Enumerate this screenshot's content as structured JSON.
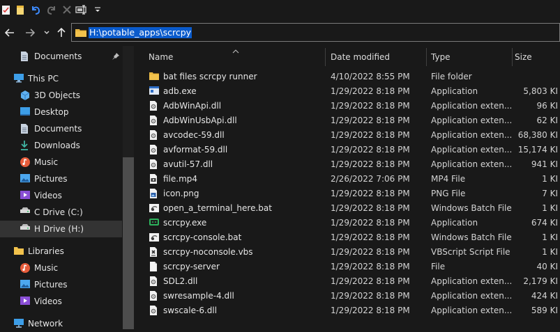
{
  "colors": {
    "background": "#191919",
    "address_selection": "#0a5bcc",
    "folder": "#f2c24c",
    "accent_blue": "#3d8bff"
  },
  "quick_access": [
    {
      "icon": "properties-icon"
    },
    {
      "icon": "new-folder-icon"
    },
    {
      "icon": "undo-icon"
    },
    {
      "icon": "redo-icon"
    },
    {
      "icon": "delete-icon"
    },
    {
      "icon": "rename-icon"
    },
    {
      "icon": "customize-dropdown-icon"
    }
  ],
  "nav": {
    "back_icon": "back-arrow-icon",
    "forward_icon": "forward-arrow-icon",
    "recent_icon": "recent-dropdown-icon",
    "up_icon": "up-arrow-icon",
    "address": "H:\\potable_apps\\scrcpy"
  },
  "sidebar": {
    "items": [
      {
        "label": "Documents",
        "icon": "documents-icon",
        "indent": 1,
        "pinned": true
      },
      {
        "label": "This PC",
        "icon": "this-pc-icon",
        "indent": 0
      },
      {
        "label": "3D Objects",
        "icon": "3d-objects-icon",
        "indent": 1
      },
      {
        "label": "Desktop",
        "icon": "desktop-icon",
        "indent": 1
      },
      {
        "label": "Documents",
        "icon": "documents-icon",
        "indent": 1
      },
      {
        "label": "Downloads",
        "icon": "downloads-icon",
        "indent": 1
      },
      {
        "label": "Music",
        "icon": "music-icon",
        "indent": 1
      },
      {
        "label": "Pictures",
        "icon": "pictures-icon",
        "indent": 1
      },
      {
        "label": "Videos",
        "icon": "videos-icon",
        "indent": 1
      },
      {
        "label": "C Drive (C:)",
        "icon": "drive-icon",
        "indent": 1
      },
      {
        "label": "H Drive (H:)",
        "icon": "drive-icon",
        "indent": 1,
        "selected": true
      },
      {
        "label": "Libraries",
        "icon": "libraries-icon",
        "indent": 0
      },
      {
        "label": "Music",
        "icon": "music-icon",
        "indent": 1
      },
      {
        "label": "Pictures",
        "icon": "pictures-icon",
        "indent": 1
      },
      {
        "label": "Videos",
        "icon": "videos-icon",
        "indent": 1
      },
      {
        "label": "Network",
        "icon": "network-icon",
        "indent": 0
      }
    ]
  },
  "columns": {
    "name": "Name",
    "date": "Date modified",
    "type": "Type",
    "size": "Size"
  },
  "files": [
    {
      "name": "bat files scrcpy runner",
      "date": "4/10/2022 8:55 PM",
      "type": "File folder",
      "size": "",
      "icon": "folder-icon"
    },
    {
      "name": "adb.exe",
      "date": "1/29/2022 8:18 PM",
      "type": "Application",
      "size": "5,803 KI",
      "icon": "exe-icon"
    },
    {
      "name": "AdbWinApi.dll",
      "date": "1/29/2022 8:18 PM",
      "type": "Application exten...",
      "size": "96 KI",
      "icon": "dll-icon"
    },
    {
      "name": "AdbWinUsbApi.dll",
      "date": "1/29/2022 8:18 PM",
      "type": "Application exten...",
      "size": "62 KI",
      "icon": "dll-icon"
    },
    {
      "name": "avcodec-59.dll",
      "date": "1/29/2022 8:18 PM",
      "type": "Application exten...",
      "size": "68,380 KI",
      "icon": "dll-icon"
    },
    {
      "name": "avformat-59.dll",
      "date": "1/29/2022 8:18 PM",
      "type": "Application exten...",
      "size": "15,174 KI",
      "icon": "dll-icon"
    },
    {
      "name": "avutil-57.dll",
      "date": "1/29/2022 8:18 PM",
      "type": "Application exten...",
      "size": "941 KI",
      "icon": "dll-icon"
    },
    {
      "name": "file.mp4",
      "date": "2/26/2022 7:06 PM",
      "type": "MP4 File",
      "size": "1 KI",
      "icon": "video-file-icon"
    },
    {
      "name": "icon.png",
      "date": "1/29/2022 8:18 PM",
      "type": "PNG File",
      "size": "7 KI",
      "icon": "image-file-icon"
    },
    {
      "name": "open_a_terminal_here.bat",
      "date": "1/29/2022 8:18 PM",
      "type": "Windows Batch File",
      "size": "1 KI",
      "icon": "batch-file-icon"
    },
    {
      "name": "scrcpy.exe",
      "date": "1/29/2022 8:18 PM",
      "type": "Application",
      "size": "674 KI",
      "icon": "scrcpy-app-icon"
    },
    {
      "name": "scrcpy-console.bat",
      "date": "1/29/2022 8:18 PM",
      "type": "Windows Batch File",
      "size": "1 KI",
      "icon": "batch-file-icon"
    },
    {
      "name": "scrcpy-noconsole.vbs",
      "date": "1/29/2022 8:18 PM",
      "type": "VBScript Script File",
      "size": "1 KI",
      "icon": "script-file-icon"
    },
    {
      "name": "scrcpy-server",
      "date": "1/29/2022 8:18 PM",
      "type": "File",
      "size": "40 KI",
      "icon": "blank-file-icon"
    },
    {
      "name": "SDL2.dll",
      "date": "1/29/2022 8:18 PM",
      "type": "Application exten...",
      "size": "2,179 KI",
      "icon": "dll-icon"
    },
    {
      "name": "swresample-4.dll",
      "date": "1/29/2022 8:18 PM",
      "type": "Application exten...",
      "size": "424 KI",
      "icon": "dll-icon"
    },
    {
      "name": "swscale-6.dll",
      "date": "1/29/2022 8:18 PM",
      "type": "Application exten...",
      "size": "589 KI",
      "icon": "dll-icon"
    }
  ]
}
